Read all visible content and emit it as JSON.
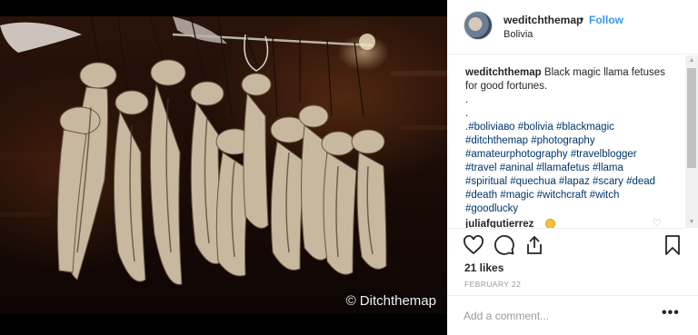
{
  "post": {
    "photo_alt": "Black magic llama fetuses hanging",
    "watermark": "© Ditchthemap"
  },
  "header": {
    "username": "weditchthemap",
    "separator": "•",
    "follow_label": "Follow",
    "location": "Bolivia"
  },
  "caption": {
    "author": "weditchthemap",
    "text": "Black magic llama fetuses for good fortunes.",
    "dots": [
      ".",
      "."
    ],
    "hashtag_lines": [
      ".#boliviaво #bolivia #blackmagic",
      "#ditchthemap #photography",
      "#amateurphotography #travelblogger",
      "#travel #aninal #llamafetus #llama",
      "#spiritual #quechua #lapaz #scary #dead",
      "#death #magic #witchcraft #witch",
      "#goodlucky"
    ]
  },
  "comment": {
    "username": "juliafgutierrez",
    "emoji": "face-emoji",
    "heart": "♡"
  },
  "scrollbar": {
    "up": "▲",
    "down": "▼"
  },
  "actions": {
    "icons": [
      "heart-icon",
      "comment-icon",
      "share-icon",
      "bookmark-icon"
    ]
  },
  "stats": {
    "likes": "21 likes",
    "date": "FEBRUARY 22"
  },
  "add_comment": {
    "placeholder": "Add a comment...",
    "more_label": "•••"
  },
  "colors": {
    "link_blue": "#3897f0",
    "hashtag": "#003569",
    "text": "#262626",
    "muted": "#999999"
  }
}
